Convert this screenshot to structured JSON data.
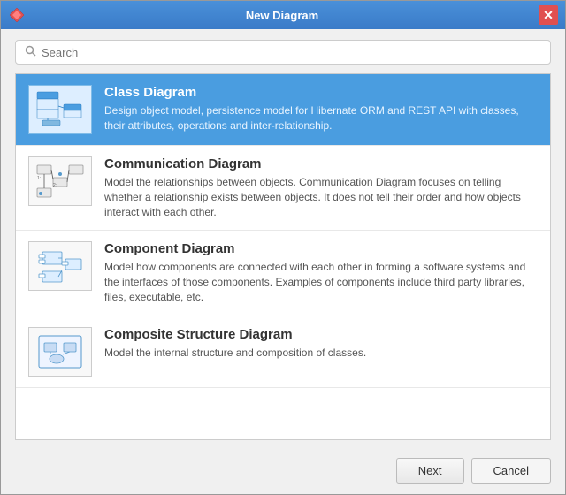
{
  "window": {
    "title": "New Diagram",
    "close_label": "✕"
  },
  "search": {
    "placeholder": "Search",
    "value": ""
  },
  "diagrams": [
    {
      "id": "class",
      "title": "Class Diagram",
      "description": "Design object model, persistence model for Hibernate ORM and REST API with classes, their attributes, operations and inter-relationship.",
      "selected": true
    },
    {
      "id": "communication",
      "title": "Communication Diagram",
      "description": "Model the relationships between objects. Communication Diagram focuses on telling whether a relationship exists between objects. It does not tell their order and how objects interact with each other.",
      "selected": false
    },
    {
      "id": "component",
      "title": "Component Diagram",
      "description": "Model how components are connected with each other in forming a software systems and the interfaces of those components. Examples of components include third party libraries, files, executable, etc.",
      "selected": false
    },
    {
      "id": "composite",
      "title": "Composite Structure Diagram",
      "description": "Model the internal structure and composition of classes.",
      "selected": false
    }
  ],
  "buttons": {
    "next": "Next",
    "cancel": "Cancel"
  },
  "colors": {
    "selected_bg": "#4a9de0",
    "titlebar_start": "#4a90d9",
    "close_btn": "#e05050"
  }
}
